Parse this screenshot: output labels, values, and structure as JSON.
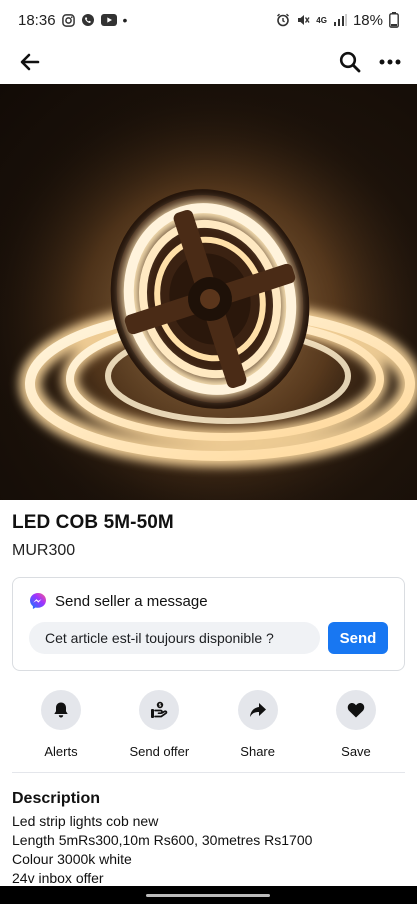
{
  "status_bar": {
    "time": "18:36",
    "battery": "18%",
    "network": "4G",
    "dot": "•"
  },
  "nav": {
    "back_icon": "arrow-left-icon",
    "search_icon": "search-icon",
    "more_icon": "more-horizontal-icon"
  },
  "listing": {
    "title": "LED COB 5M-50M",
    "price": "MUR300"
  },
  "message": {
    "header": "Send seller a message",
    "input_value": "Cet article est-il toujours disponible ?",
    "send_label": "Send"
  },
  "actions": [
    {
      "label": "Alerts",
      "icon": "bell-icon"
    },
    {
      "label": "Send offer",
      "icon": "offer-icon"
    },
    {
      "label": "Share",
      "icon": "share-icon"
    },
    {
      "label": "Save",
      "icon": "heart-icon"
    }
  ],
  "description": {
    "heading": "Description",
    "lines": [
      "Led strip lights cob new",
      "Length 5mRs300,10m Rs600, 30metres Rs1700",
      "Colour 3000k white",
      "24v inbox offer"
    ]
  },
  "colors": {
    "accent": "#1877f2",
    "chip_bg": "#e4e6eb",
    "input_bg": "#f0f2f5"
  }
}
